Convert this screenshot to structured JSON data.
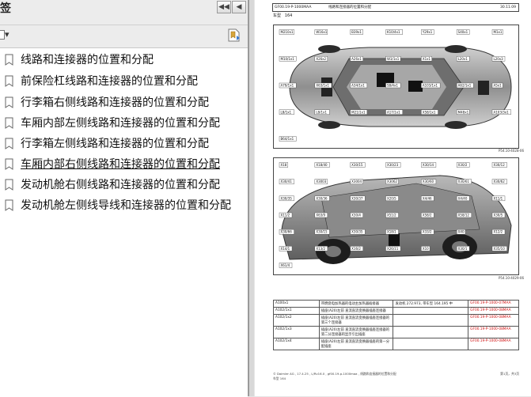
{
  "panel": {
    "title": "签",
    "collapse_label": "◀◀",
    "close_label": "◀",
    "options_label": "▾"
  },
  "bookmarks": [
    {
      "label": "线路和连接器的位置和分配"
    },
    {
      "label": "前保险杠线路和连接器的位置和分配"
    },
    {
      "label": "行李箱右侧线路和连接器的位置和分配"
    },
    {
      "label": "车厢内部左侧线路和连接器的位置和分配"
    },
    {
      "label": "行李箱左侧线路和连接器的位置和分配"
    },
    {
      "label": "车厢内部右侧线路和连接器的位置和分配"
    },
    {
      "label": "发动机舱右侧线路和连接器的位置和分配"
    },
    {
      "label": "发动机舱左侧线导线和连接器的位置和分配"
    }
  ],
  "document": {
    "header_code": "GF00.19-P-1000MAA",
    "header_title": "线路和连接器的位置和分配",
    "header_date": "30.11.09",
    "model_label": "车型",
    "model_value": "164",
    "figure1_caption": "P54.10-4028-06",
    "figure2_caption": "P54.10-4029-06",
    "figure1_labels": [
      "M210x1",
      "W16x1",
      "B39x1",
      "K10/4x1",
      "Y29x1",
      "S40x1",
      "M1x1",
      "M10/1x1",
      "X26x2",
      "A26x1",
      "W3/1x1",
      "X1x1",
      "L20x1",
      "L20x3",
      "A79/1x1",
      "X63/1x1",
      "A34/1x1",
      "S8/4x1",
      "A103/1x1",
      "A62/1x1",
      "A5x1",
      "L8/1x1",
      "L8/1x1",
      "M21/1x1",
      "A17/1x1",
      "X58/1x1",
      "M48x1",
      "A103/3x1",
      "B64/1x1"
    ],
    "figure2_labels": [
      "X18",
      "X18/40",
      "X30/15",
      "X30/23",
      "X30/14",
      "X30/2",
      "X30/12",
      "X30/41",
      "X3003",
      "X3004",
      "X3062",
      "X30/60",
      "X30/61",
      "X30/62",
      "X30/35",
      "X30/36",
      "X30/37",
      "X20/5",
      "X4/46",
      "X4/40",
      "X11/1",
      "X11/2",
      "X63/9",
      "X30/4",
      "X51/2",
      "X58/2",
      "X58/12",
      "X30/5",
      "X30/66",
      "X30/15",
      "X30/35",
      "X18/1",
      "X33/2",
      "X40",
      "X12/2",
      "X14/1",
      "X13/2",
      "X16/2",
      "X26/11",
      "X10",
      "X30/1",
      "X35/10",
      "X61/4"
    ],
    "table": [
      {
        "code": "A100x1",
        "desc": "带燃烧电加热器的电动主加热器插接器",
        "note": "发动机 272.973, 带车型 164.195 中",
        "ref": "GF00.19-P-1000-07MAA"
      },
      {
        "code": "A102/1x1",
        "desc": "插座(A20)左前 直流直流变换器插座连接器",
        "note": "",
        "ref": "GF00.19-P-1000-08MAA"
      },
      {
        "code": "A102/1x2",
        "desc": "插座(A20)左前 直流直流变换器插座连接器的第三个连接器",
        "note": "",
        "ref": "GF00.19-P-1000-08MAA"
      },
      {
        "code": "A102/1x3",
        "desc": "插座(A20)左前 直流直流变换器插座连接器的第二分连接器的显示引出插座",
        "note": "",
        "ref": "GF00.19-P-1000-08MAA"
      },
      {
        "code": "A102/1x4",
        "desc": "插座(A20)左前 直流直流变换器插座的第一分配插座",
        "note": "",
        "ref": "GF00.19-P-1000-08MAA"
      }
    ],
    "footer_left": "© Daimler AG , 17.4.25 , L/Rv16.0 , gf00.19-p-1000maa , 线路和连接器的位置和分配",
    "footer_right": "第1页，共3页",
    "footer_line2": "车型 164"
  }
}
